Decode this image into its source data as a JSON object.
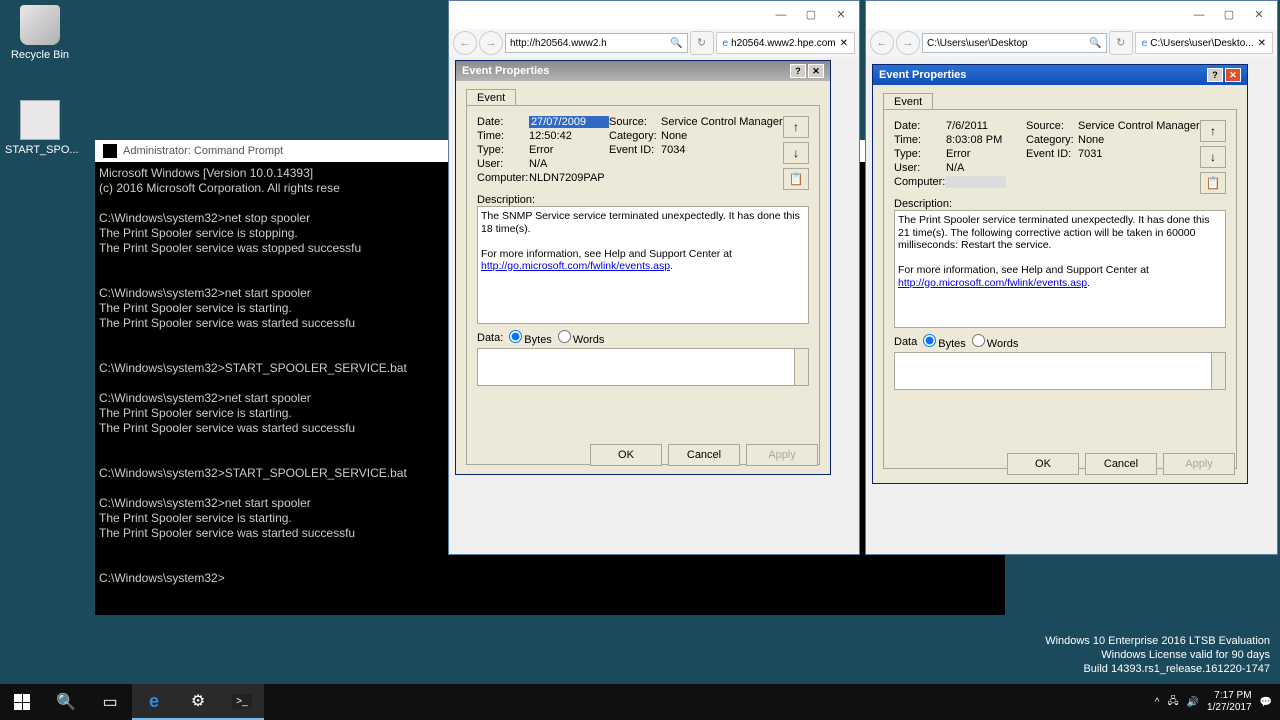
{
  "desktop": {
    "recycle": "Recycle Bin",
    "batfile": "START_SPO..."
  },
  "cmd": {
    "title": "Administrator: Command Prompt",
    "body": "Microsoft Windows [Version 10.0.14393]\n(c) 2016 Microsoft Corporation. All rights rese\n\nC:\\Windows\\system32>net stop spooler\nThe Print Spooler service is stopping.\nThe Print Spooler service was stopped successfu\n\n\nC:\\Windows\\system32>net start spooler\nThe Print Spooler service is starting.\nThe Print Spooler service was started successfu\n\n\nC:\\Windows\\system32>START_SPOOLER_SERVICE.bat\n\nC:\\Windows\\system32>net start spooler\nThe Print Spooler service is starting.\nThe Print Spooler service was started successfu\n\n\nC:\\Windows\\system32>START_SPOOLER_SERVICE.bat\n\nC:\\Windows\\system32>net start spooler\nThe Print Spooler service is starting.\nThe Print Spooler service was started successfu\n\n\nC:\\Windows\\system32>"
  },
  "ie_left": {
    "address": "http://h20564.www2.h",
    "tab": "h20564.www2.hpe.com"
  },
  "ie_right": {
    "address": "C:\\Users\\user\\Desktop",
    "tab": "C:\\Users\\user\\Deskto..."
  },
  "evt_left": {
    "title": "Event Properties",
    "tab": "Event",
    "date_l": "Date:",
    "date_v": "27/07/2009",
    "time_l": "Time:",
    "time_v": "12:50:42",
    "type_l": "Type:",
    "type_v": "Error",
    "user_l": "User:",
    "user_v": "N/A",
    "comp_l": "Computer:",
    "comp_v": "NLDN7209PAP",
    "src_l": "Source:",
    "src_v": "Service Control Manager",
    "cat_l": "Category:",
    "cat_v": "None",
    "eid_l": "Event ID:",
    "eid_v": "7034",
    "desc_l": "Description:",
    "desc": "The SNMP Service service terminated unexpectedly.  It has done this 18 time(s).",
    "more": "For more information, see Help and Support Center at ",
    "link": "http://go.microsoft.com/fwlink/events.asp",
    "data_l": "Data:",
    "bytes": "Bytes",
    "words": "Words",
    "ok": "OK",
    "cancel": "Cancel",
    "apply": "Apply"
  },
  "evt_right": {
    "title": "Event Properties",
    "tab": "Event",
    "date_l": "Date:",
    "date_v": "7/6/2011",
    "time_l": "Time:",
    "time_v": "8:03:08 PM",
    "type_l": "Type:",
    "type_v": "Error",
    "user_l": "User:",
    "user_v": "N/A",
    "comp_l": "Computer:",
    "comp_v": "",
    "src_l": "Source:",
    "src_v": "Service Control Manager",
    "cat_l": "Category:",
    "cat_v": "None",
    "eid_l": "Event ID:",
    "eid_v": "7031",
    "desc_l": "Description:",
    "desc": "The Print Spooler service terminated unexpectedly.  It has done this 21 time(s).  The following corrective action will be taken in 60000 milliseconds: Restart the service.",
    "more": "For more information, see Help and Support Center at ",
    "link": "http://go.microsoft.com/fwlink/events.asp",
    "data_l": "Data",
    "bytes": "Bytes",
    "words": "Words",
    "ok": "OK",
    "cancel": "Cancel",
    "apply": "Apply"
  },
  "watermark": {
    "l1": "Windows 10 Enterprise 2016 LTSB Evaluation",
    "l2": "Windows License valid for 90 days",
    "l3": "Build 14393.rs1_release.161220-1747"
  },
  "tray": {
    "time": "7:17 PM",
    "date": "1/27/2017"
  }
}
